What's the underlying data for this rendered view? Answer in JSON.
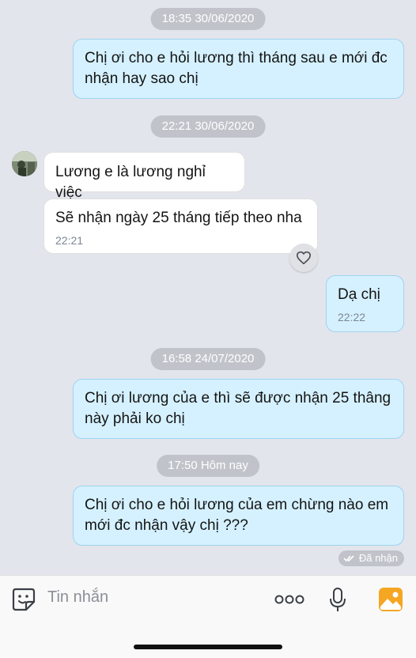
{
  "messages": [
    {
      "type": "time",
      "text": "18:35 30/06/2020"
    },
    {
      "type": "out",
      "text": "Chị ơi cho e hỏi lương thì tháng sau e mới đc nhận hay sao chị"
    },
    {
      "type": "time",
      "text": "22:21 30/06/2020"
    },
    {
      "type": "in",
      "text": "Lương e là lương nghỉ việc"
    },
    {
      "type": "in",
      "text": "Sẽ nhận ngày 25 tháng tiếp theo nha",
      "time": "22:21"
    },
    {
      "type": "out",
      "text": "Dạ chị",
      "time": "22:22"
    },
    {
      "type": "time",
      "text": "16:58 24/07/2020"
    },
    {
      "type": "out",
      "text": "Chị ơi lương của e thì sẽ được nhận 25 thâng này phải ko chị"
    },
    {
      "type": "time",
      "text": "17:50 Hôm nay"
    },
    {
      "type": "out",
      "text": "Chị ơi cho e hỏi lương của em chừng nào em mới đc nhận vậy chị ???"
    }
  ],
  "status": {
    "seen_label": "Đã nhận"
  },
  "composer": {
    "placeholder": "Tin nhắn"
  },
  "colors": {
    "outgoing_bubble": "#d5f1ff",
    "incoming_bubble": "#ffffff",
    "background": "#e3e5ec",
    "accent": "#f5a623"
  }
}
